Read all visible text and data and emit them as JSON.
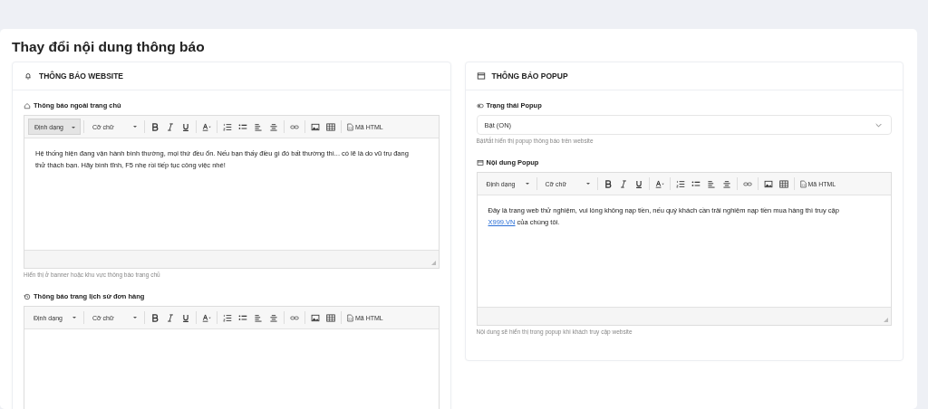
{
  "page_title": "Thay đổi nội dung thông báo",
  "cards": [
    {
      "title": "THÔNG BÁO WEBSITE",
      "fields": [
        {
          "kind": "editor",
          "label": "Thông báo ngoài trang chủ",
          "toolbar": {
            "format": "Định dạng",
            "format_active": true,
            "size": "Cỡ chữ",
            "html": "Mã HTML"
          },
          "content": [
            {
              "text": "Hệ thống hiện đang vận hành bình thường, mọi thứ đều ổn. Nếu bạn thấy điều gì đó bất thường thì... có lẽ là do vũ trụ đang thử thách bạn. Hãy bình tĩnh, F5 nhẹ rồi tiếp tục công việc nhé!"
            }
          ],
          "hint": "Hiển thị ở banner hoặc khu vực thông báo trang chủ"
        },
        {
          "kind": "editor",
          "label": "Thông báo trang lịch sử đơn hàng",
          "toolbar": {
            "format": "Định dạng",
            "format_active": false,
            "size": "Cỡ chữ",
            "html": "Mã HTML"
          }
        }
      ]
    },
    {
      "title": "THÔNG BÁO POPUP",
      "fields": [
        {
          "kind": "select",
          "label": "Trạng thái Popup",
          "value": "Bật (ON)",
          "hint": "Bật/tắt hiển thị popup thông báo trên website"
        },
        {
          "kind": "editor",
          "label": "Nội dung Popup",
          "toolbar": {
            "format": "Định dạng",
            "format_active": false,
            "size": "Cỡ chữ",
            "html": "Mã HTML"
          },
          "content": [
            {
              "text": "Đây là trang web thử nghiệm, vui lòng không nạp tiền, nếu quý khách cần trải nghiệm nạp tiền mua hàng thì truy cập "
            },
            {
              "link": "X999.VN"
            },
            {
              "text": " của chúng tôi."
            }
          ],
          "hint": "Nội dung sẽ hiển thị trong popup khi khách truy cập website"
        }
      ]
    }
  ]
}
